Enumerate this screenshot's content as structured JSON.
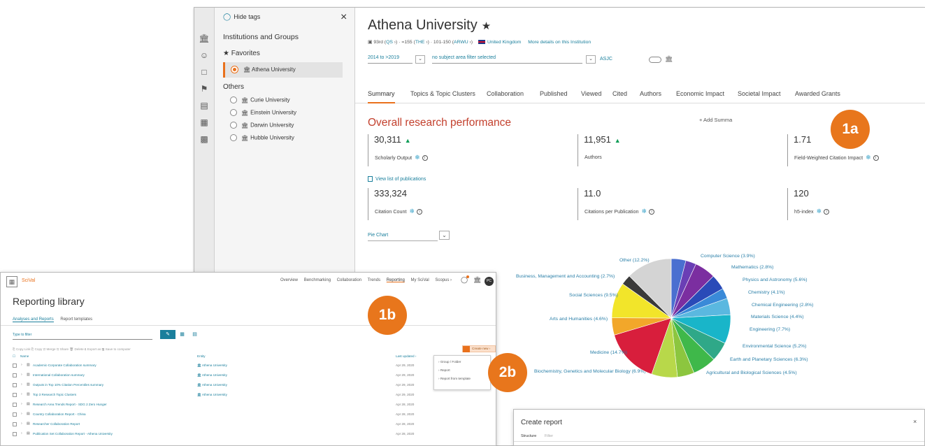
{
  "main": {
    "hide_tags": "Hide tags",
    "close": "×",
    "panel": {
      "institutions_heading": "Institutions and Groups",
      "favorites_heading": "★ Favorites",
      "favorite_selected": "Athena University",
      "others_heading": "Others",
      "others": [
        "Curie University",
        "Einstein University",
        "Darwin University",
        "Hubble University"
      ]
    },
    "entity": {
      "title": "Athena University",
      "star": "★",
      "rank_prefix": "93rd (",
      "qs": "QS",
      "rank_mid1": " ›) · =155 (",
      "the": "THE",
      "rank_mid2": " ›) · 101-150 (",
      "arwu": "ARWU",
      "rank_suffix": " ›)",
      "country": "United Kingdom",
      "more_details": "More details on this Institution"
    },
    "filters": {
      "years": "2014 to >2019",
      "subject": "no subject area filter selected",
      "classification": "ASJC"
    },
    "tabs": [
      "Summary",
      "Topics & Topic Clusters",
      "Collaboration",
      "Published",
      "Viewed",
      "Cited",
      "Authors",
      "Economic Impact",
      "Societal Impact",
      "Awarded Grants"
    ],
    "add_summary": "+ Add Summa",
    "section_title": "Overall research performance",
    "metrics": {
      "scholarly_output": {
        "value": "30,311",
        "label": "Scholarly Output",
        "trend": "▲"
      },
      "authors": {
        "value": "11,951",
        "label": "Authors",
        "trend": "▲"
      },
      "fwci": {
        "value": "1.71",
        "label": "Field-Weighted Citation Impact"
      },
      "citation_count": {
        "value": "333,324",
        "label": "Citation Count"
      },
      "citations_per_pub": {
        "value": "11.0",
        "label": "Citations per Publication"
      },
      "h5_index": {
        "value": "120",
        "label": "h5-index"
      }
    },
    "view_list": "View list of publications",
    "chart_selector": "Pie Chart"
  },
  "badges": {
    "a1": "1a",
    "b1": "1b",
    "b2": "2b"
  },
  "chart_data": {
    "type": "pie",
    "unit": "%",
    "slices": [
      {
        "label": "Computer Science (3.9%)",
        "value": 3.9,
        "color": "#4a6fd0"
      },
      {
        "label": "Mathematics (2.8%)",
        "value": 2.8,
        "color": "#6a3fb5"
      },
      {
        "label": "Physics and Astronomy (5.6%)",
        "value": 5.6,
        "color": "#7b2ea0"
      },
      {
        "label": "Chemistry (4.1%)",
        "value": 4.1,
        "color": "#2a4ab8"
      },
      {
        "label": "Chemical Engineering (2.8%)",
        "value": 2.8,
        "color": "#3a8ad8"
      },
      {
        "label": "Materials Science (4.4%)",
        "value": 4.4,
        "color": "#5ab8e0"
      },
      {
        "label": "Engineering (7.7%)",
        "value": 7.7,
        "color": "#19b5c9"
      },
      {
        "label": "Environmental Science (5.2%)",
        "value": 5.2,
        "color": "#2fa888"
      },
      {
        "label": "Earth and Planetary Sciences (6.3%)",
        "value": 6.3,
        "color": "#3fb84a"
      },
      {
        "label": "Agricultural and Biological Sciences (4.5%)",
        "value": 4.5,
        "color": "#8cc63f"
      },
      {
        "label": "Biochemistry, Genetics and Molecular Biology (6.9%)",
        "value": 6.9,
        "color": "#b8d84a"
      },
      {
        "label": "Medicine (14.7%)",
        "value": 14.7,
        "color": "#d81e3c"
      },
      {
        "label": "Arts and Humanities (4.6%)",
        "value": 4.6,
        "color": "#f2a72a"
      },
      {
        "label": "Social Sciences (9.5%)",
        "value": 9.5,
        "color": "#f2e52a"
      },
      {
        "label": "Business, Management and Accounting (2.7%)",
        "value": 2.7,
        "color": "#3a3a3a"
      },
      {
        "label": "Other (12.2%)",
        "value": 12.2,
        "color": "#d4d4d4"
      }
    ]
  },
  "reporting": {
    "app_name": "SciVal",
    "nav": [
      "Overview",
      "Benchmarking",
      "Collaboration",
      "Trends",
      "Reporting",
      "My SciVal",
      "Scopus ›"
    ],
    "avatar": "PC",
    "title": "Reporting library",
    "subtabs": [
      "Analyses and Reports",
      "Report templates"
    ],
    "filter_placeholder": "Type to filter",
    "actions": "⎘ Copy Link   ⎘ Copy   ⇄ Merge   ⇆ Share   🗑 Delete   ⇩ Export as   🖫 Save to computer",
    "create_new": "Create new ›",
    "headers": {
      "name": "Name",
      "entity": "Entity",
      "updated": "Last updated ›"
    },
    "rows": [
      {
        "name": "Academic-Corporate Collaboration summary",
        "entity": "Athena University",
        "date": "Apr 29, 2020",
        "icon": "chart-icon"
      },
      {
        "name": "International Collaboration summary",
        "entity": "Athena University",
        "date": "Apr 29, 2020",
        "icon": "chart-icon"
      },
      {
        "name": "Outputs in Top 10% Citation Percentiles summary",
        "entity": "Athena University",
        "date": "Apr 29, 2020",
        "icon": "chart-icon"
      },
      {
        "name": "Top 3 Research Topic Clusters",
        "entity": "Athena University",
        "date": "Apr 29, 2020",
        "icon": "chart-icon"
      },
      {
        "name": "Research Area Trends Report - SDG 2 Zero Hunger",
        "entity": "",
        "date": "Apr 28, 2020",
        "icon": "report-icon"
      },
      {
        "name": "Country Collaboration Report - China",
        "entity": "",
        "date": "Apr 28, 2020",
        "icon": "report-icon"
      },
      {
        "name": "Researcher Collaboration Report",
        "entity": "",
        "date": "Apr 28, 2020",
        "icon": "report-icon"
      },
      {
        "name": "Publication Set Collaboration Report - Athena University",
        "entity": "",
        "date": "Apr 28, 2020",
        "icon": "report-icon"
      }
    ],
    "dropdown": [
      "Group / Folder",
      "Report",
      "Report from template"
    ]
  },
  "create_report": {
    "title": "Create report",
    "close": "×",
    "tabs": [
      "Structure",
      "Filter"
    ]
  }
}
